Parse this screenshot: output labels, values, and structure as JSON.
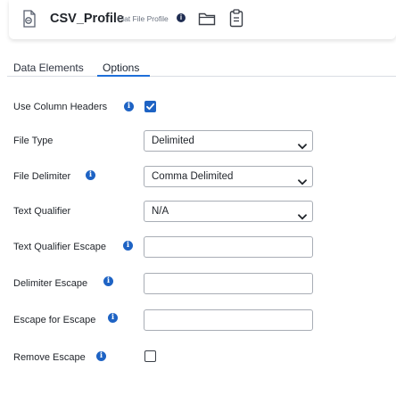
{
  "header": {
    "title": "CSV_Profile",
    "subtitle": "Flat File Profile",
    "info_glyph": "i",
    "icons": [
      "flat-file-profile-icon",
      "folder-icon",
      "clipboard-icon"
    ]
  },
  "tabs": [
    {
      "label": "Data Elements",
      "active": false
    },
    {
      "label": "Options",
      "active": true
    }
  ],
  "form": {
    "use_column_headers": {
      "label": "Use Column Headers",
      "checked": true
    },
    "file_type": {
      "label": "File Type",
      "value": "Delimited"
    },
    "file_delimiter": {
      "label": "File Delimiter",
      "value": "Comma Delimited"
    },
    "text_qualifier": {
      "label": "Text Qualifier",
      "value": "N/A"
    },
    "text_qualifier_escape": {
      "label": "Text Qualifier Escape",
      "value": ""
    },
    "delimiter_escape": {
      "label": "Delimiter Escape",
      "value": ""
    },
    "escape_for_escape": {
      "label": "Escape for Escape",
      "value": ""
    },
    "remove_escape": {
      "label": "Remove Escape",
      "checked": false
    }
  },
  "colors": {
    "accent": "#1e63c4",
    "tab_underline": "#1e6fd9",
    "info_dark": "#1f2d52"
  }
}
